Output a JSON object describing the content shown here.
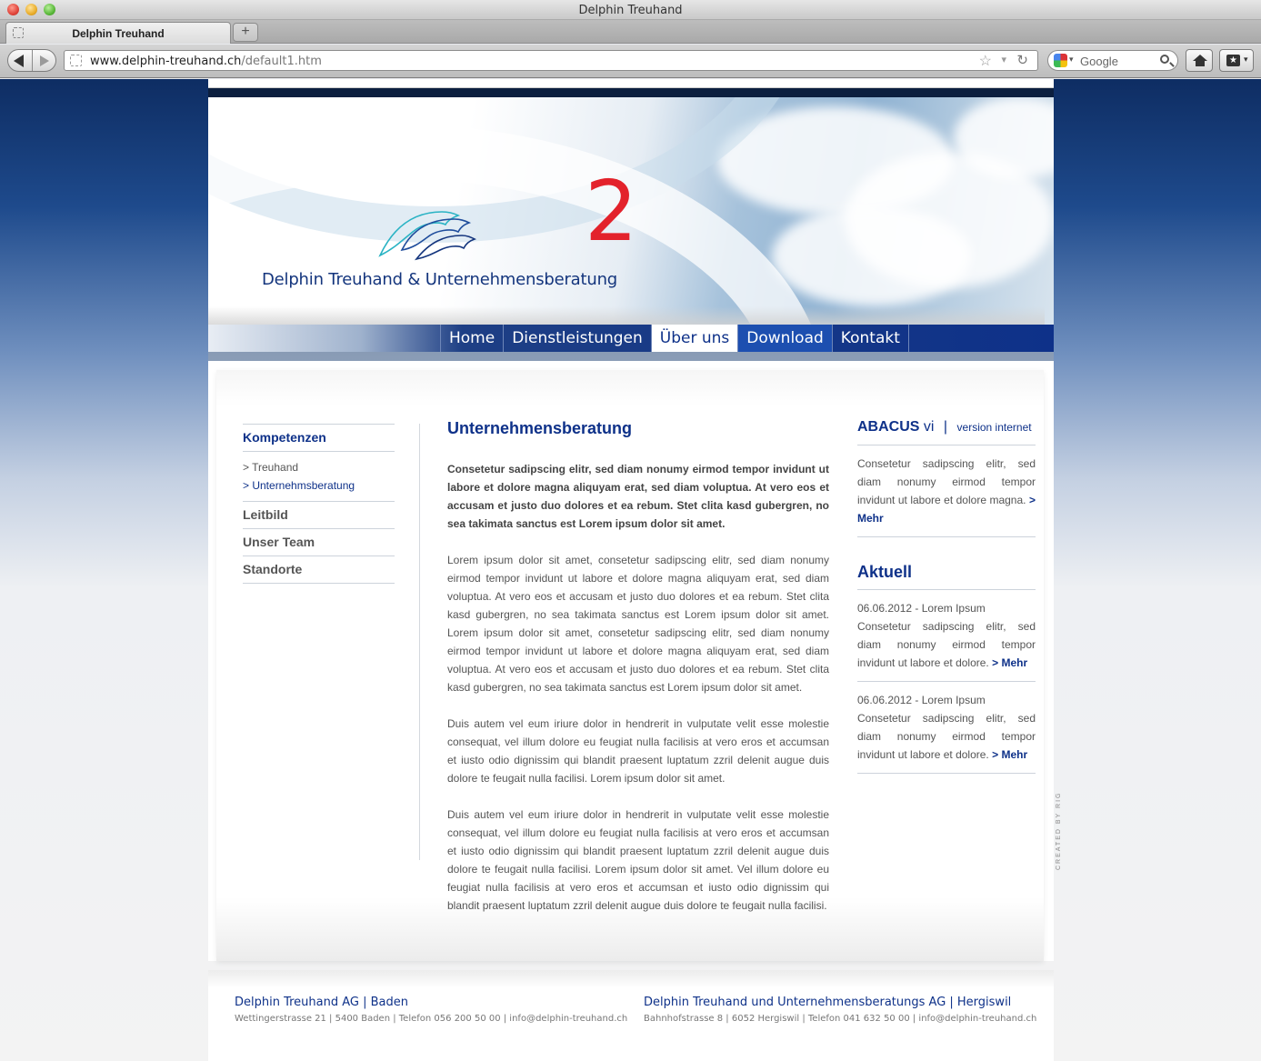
{
  "window": {
    "title": "Delphin Treuhand"
  },
  "tabs": [
    {
      "label": "Delphin Treuhand"
    }
  ],
  "newtab_label": "+",
  "url": {
    "host": "www.delphin-treuhand.ch",
    "path": "/default1.htm"
  },
  "search": {
    "placeholder": "Google"
  },
  "site": {
    "logo_text": "Delphin Treuhand & Unternehmensberatung",
    "big_number": "2",
    "nav": [
      {
        "label": "Home",
        "state": "normal"
      },
      {
        "label": "Dienstleistungen",
        "state": "normal"
      },
      {
        "label": "Über uns",
        "state": "active"
      },
      {
        "label": "Download",
        "state": "hover"
      },
      {
        "label": "Kontakt",
        "state": "normal"
      }
    ],
    "sidebar": {
      "heading": "Kompetenzen",
      "sub_items": [
        "> Treuhand",
        "> Unternehmsberatung"
      ],
      "items": [
        "Leitbild",
        "Unser Team",
        "Standorte"
      ]
    },
    "main": {
      "title": "Unternehmensberatung",
      "lead": "Consetetur sadipscing elitr, sed diam nonumy eirmod tempor invidunt ut labore et dolore magna aliquyam erat, sed diam voluptua. At vero eos et accusam et justo duo dolores et ea rebum. Stet clita kasd gubergren, no sea takimata sanctus est Lorem ipsum dolor sit amet.",
      "p1": "Lorem ipsum dolor sit amet, consetetur sadipscing elitr, sed diam nonumy eirmod tempor invidunt ut labore et dolore magna aliquyam erat, sed diam voluptua. At vero eos et accusam et justo duo dolores et ea rebum. Stet clita kasd gubergren, no sea takimata sanctus est Lorem ipsum dolor sit amet. Lorem ipsum dolor sit amet, consetetur sadipscing elitr, sed diam nonumy eirmod tempor invidunt ut labore et dolore magna aliquyam erat, sed diam voluptua. At vero eos et accusam et justo duo dolores et ea rebum. Stet clita kasd gubergren, no sea takimata sanctus est Lorem ipsum dolor sit amet.",
      "p2": "Duis autem vel eum iriure dolor in hendrerit in vulputate velit esse molestie consequat, vel illum dolore eu feugiat nulla facilisis at vero eros et accumsan et iusto odio dignissim qui blandit praesent luptatum zzril delenit augue duis dolore te feugait nulla facilisi. Lorem ipsum dolor sit amet.",
      "p3": "Duis autem vel eum iriure dolor in hendrerit in vulputate velit esse molestie consequat, vel illum dolore eu feugiat nulla facilisis at vero eros et accumsan et iusto odio dignissim qui blandit praesent luptatum zzril delenit augue duis dolore te feugait nulla facilisi. Lorem ipsum dolor sit amet. Vel illum dolore eu feugiat nulla facilisis at vero eros et accumsan et iusto odio dignissim qui blandit praesent luptatum zzril delenit augue duis dolore te feugait nulla facilisi."
    },
    "right": {
      "abacus_title": "ABACUS",
      "abacus_vi": "vi",
      "abacus_sep": "|",
      "abacus_version": "version internet",
      "abacus_text": "Consetetur sadipscing elitr, sed diam nonumy eirmod tempor invidunt ut labore et dolore magna.",
      "more_label": "> Mehr",
      "aktuell_title": "Aktuell",
      "news": [
        {
          "date": "06.06.2012 - Lorem Ipsum",
          "text": "Consetetur sadipscing elitr, sed diam nonumy eirmod tempor invidunt ut labore et dolore."
        },
        {
          "date": "06.06.2012 - Lorem Ipsum",
          "text": "Consetetur sadipscing elitr, sed diam nonumy eirmod tempor invidunt ut labore et dolore."
        }
      ]
    },
    "created_by": "CREATED BY",
    "created_by_brand": "RIG",
    "footer": [
      {
        "title": "Delphin Treuhand AG  |  Baden",
        "address": "Wettingerstrasse 21   |   5400 Baden   |   Telefon 056 200 50 00   |   info@delphin-treuhand.ch"
      },
      {
        "title": "Delphin Treuhand und Unternehmensberatungs AG  |  Hergiswil",
        "address": "Bahnhofstrasse 8   |   6052 Hergiswil   |   Telefon 041 632 50 00   |   info@delphin-treuhand.ch"
      }
    ]
  },
  "colors": {
    "brand_blue": "#0e3189",
    "accent_red": "#e3222b"
  }
}
